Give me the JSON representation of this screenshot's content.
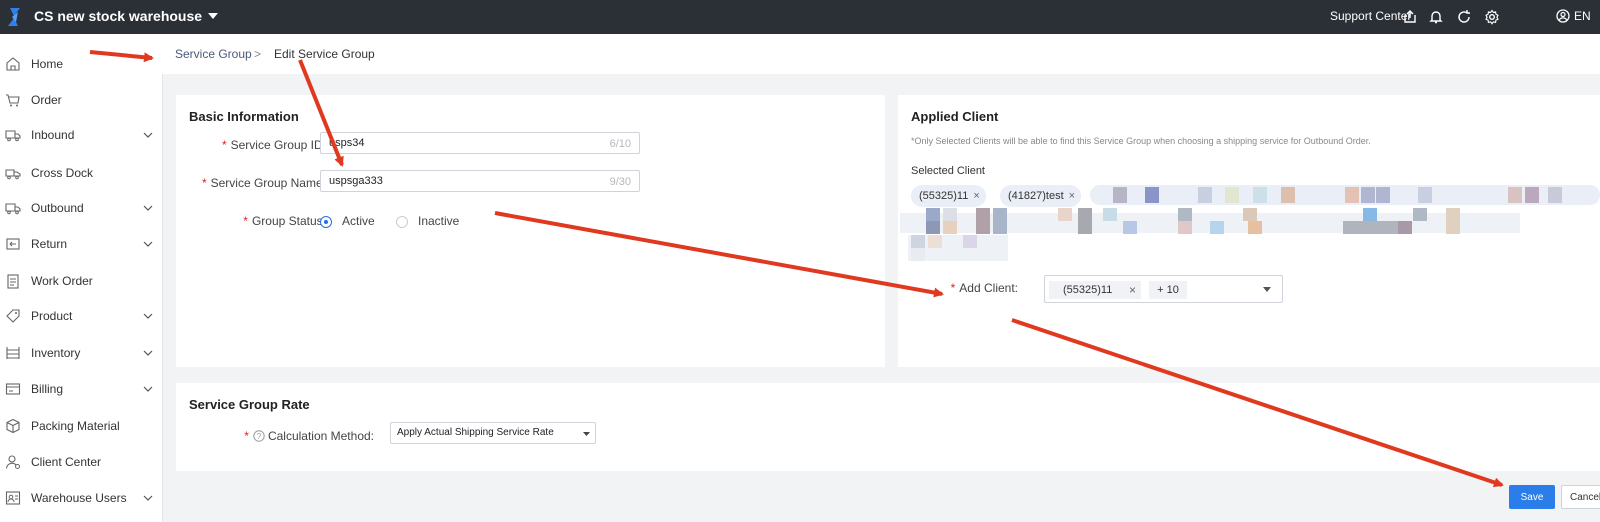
{
  "header": {
    "warehouse": "CS new stock warehouse",
    "support": "Support Center",
    "language": "EN"
  },
  "sidebar": {
    "items": [
      {
        "label": "Home",
        "icon": "home-icon"
      },
      {
        "label": "Order",
        "icon": "cart-icon"
      },
      {
        "label": "Inbound",
        "icon": "truck-in-icon"
      },
      {
        "label": "Cross Dock",
        "icon": "cross-dock-icon"
      },
      {
        "label": "Outbound",
        "icon": "truck-out-icon"
      },
      {
        "label": "Return",
        "icon": "return-icon"
      },
      {
        "label": "Work Order",
        "icon": "clipboard-icon"
      },
      {
        "label": "Product",
        "icon": "tag-icon"
      },
      {
        "label": "Inventory",
        "icon": "shelf-icon"
      },
      {
        "label": "Billing",
        "icon": "billing-icon"
      },
      {
        "label": "Packing Material",
        "icon": "box-icon"
      },
      {
        "label": "Client Center",
        "icon": "user-settings-icon"
      },
      {
        "label": "Warehouse Users",
        "icon": "users-icon"
      }
    ]
  },
  "breadcrumb": {
    "parent": "Service Group",
    "separator": ">",
    "current": "Edit Service Group"
  },
  "basic": {
    "title": "Basic Information",
    "id_label": "Service Group ID:",
    "id_value": "usps34",
    "id_count": "6/10",
    "name_label": "Service Group Name:",
    "name_value": "uspsga333",
    "name_count": "9/30",
    "status_label": "Group Status:",
    "active": "Active",
    "inactive": "Inactive",
    "selected_status": "Active"
  },
  "client": {
    "title": "Applied Client",
    "note": "*Only Selected Clients will be able to find this Service Group when choosing a shipping service for Outbound Order.",
    "selected_label": "Selected Client",
    "tags": [
      "(55325)11",
      "(41827)test"
    ],
    "add_label": "Add Client:",
    "add_value": "(55325)11",
    "add_more": "+ 10"
  },
  "rate": {
    "title": "Service Group Rate",
    "method_label": "Calculation Method:",
    "method_value": "Apply Actual Shipping Service Rate"
  },
  "actions": {
    "save": "Save",
    "cancel": "Cancel"
  },
  "colors": {
    "topbar": "#2b2f36",
    "primary": "#2b7de9",
    "annotation_arrow": "#e0391f",
    "required": "#e02020"
  }
}
